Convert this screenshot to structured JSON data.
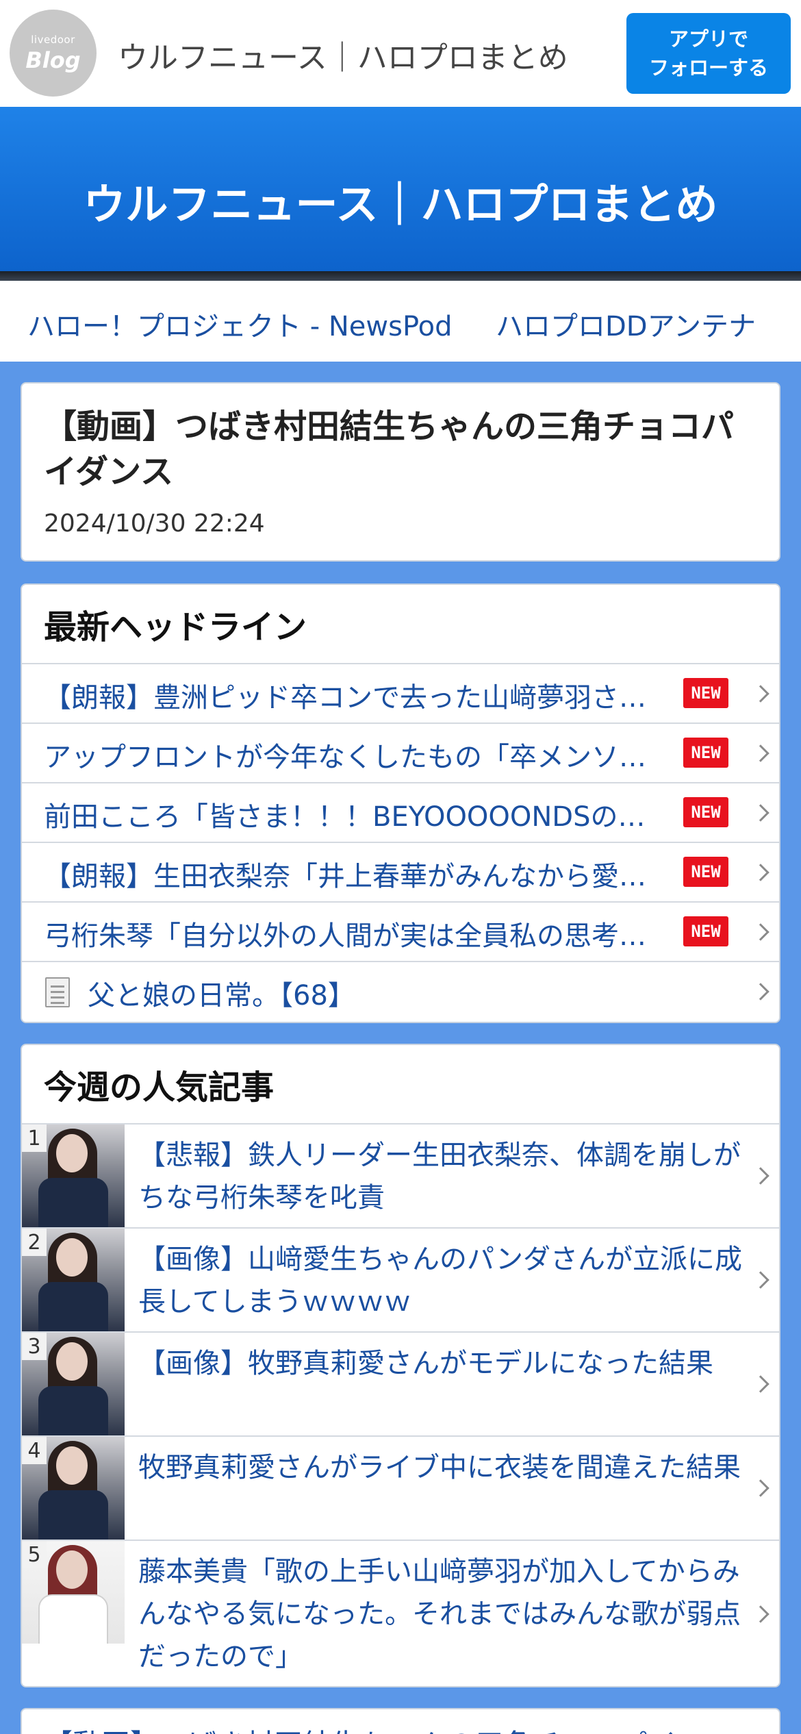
{
  "topbar": {
    "logo_small": "livedoor",
    "logo_big": "Blog",
    "site_name": "ウルフニュース｜ハロプロまとめ",
    "follow_line1": "アプリで",
    "follow_line2": "フォローする"
  },
  "banner": {
    "title": "ウルフニュース｜ハロプロまとめ"
  },
  "links": [
    {
      "label": "ハロー！プロジェクト - NewsPod"
    },
    {
      "label": "ハロプロDDアンテナ"
    }
  ],
  "article": {
    "title": "【動画】つばき村田結生ちゃんの三角チョコパイダンス",
    "date": "2024/10/30 22:24"
  },
  "headlines": {
    "header": "最新ヘッドライン",
    "new_badge": "NEW",
    "items": [
      {
        "text": "【朗報】豊洲ピッド卒コンで去った山﨑夢羽さ…",
        "is_new": true
      },
      {
        "text": "アップフロントが今年なくしたもの「卒メンソ…",
        "is_new": true
      },
      {
        "text": "前田こころ「皆さま！！！BEYOOOOONDSの…",
        "is_new": true
      },
      {
        "text": "【朗報】生田衣梨奈「井上春華がみんなから愛…",
        "is_new": true
      },
      {
        "text": "弓桁朱琴「自分以外の人間が実は全員私の思考…",
        "is_new": true
      },
      {
        "text": "父と娘の日常。【68】",
        "is_new": false
      }
    ]
  },
  "popular": {
    "header": "今週の人気記事",
    "items": [
      {
        "rank": "1",
        "text": "【悲報】鉄人リーダー生田衣梨奈、体調を崩しがちな弓桁朱琴を叱責"
      },
      {
        "rank": "2",
        "text": "【画像】山﨑愛生ちゃんのパンダさんが立派に成長してしまうｗｗｗｗ"
      },
      {
        "rank": "3",
        "text": "【画像】牧野真莉愛さんがモデルになった結果"
      },
      {
        "rank": "4",
        "text": "牧野真莉愛さんがライブ中に衣装を間違えた結果"
      },
      {
        "rank": "5",
        "text": "藤本美貴「歌の上手い山﨑夢羽が加入してからみんなやる気になった。それまではみんな歌が弱点だったので」"
      }
    ]
  },
  "bottom": {
    "text": "【動画】つばき村田結生ちゃんの三角チョコパイ"
  }
}
